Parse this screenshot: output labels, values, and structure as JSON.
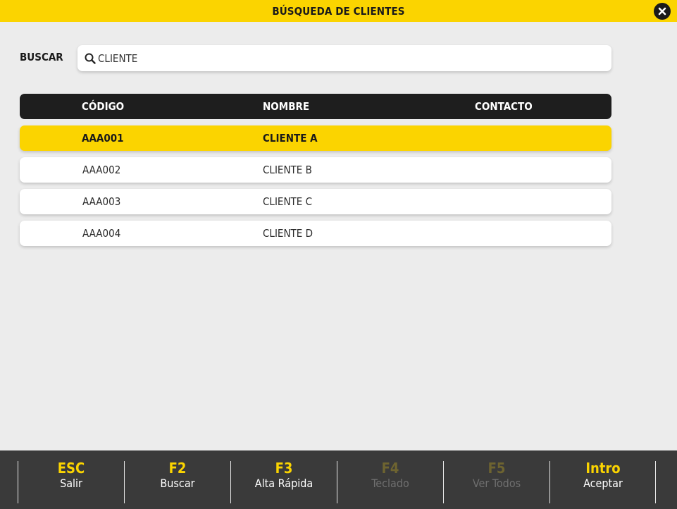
{
  "window": {
    "title": "BÚSQUEDA DE CLIENTES"
  },
  "search": {
    "label": "BUSCAR",
    "value": "CLIENTE",
    "icon": "search-icon"
  },
  "table": {
    "headers": [
      "CÓDIGO",
      "NOMBRE",
      "CONTACTO"
    ],
    "rows": [
      {
        "code": "AAA001",
        "name": "CLIENTE A",
        "contact": "",
        "selected": true
      },
      {
        "code": "AAA002",
        "name": "CLIENTE B",
        "contact": "",
        "selected": false
      },
      {
        "code": "AAA003",
        "name": "CLIENTE C",
        "contact": "",
        "selected": false
      },
      {
        "code": "AAA004",
        "name": "CLIENTE D",
        "contact": "",
        "selected": false
      }
    ]
  },
  "footer": {
    "keys": [
      {
        "key": "ESC",
        "label": "Salir",
        "enabled": true
      },
      {
        "key": "F2",
        "label": "Buscar",
        "enabled": true
      },
      {
        "key": "F3",
        "label": "Alta Rápida",
        "enabled": true
      },
      {
        "key": "F4",
        "label": "Teclado",
        "enabled": false
      },
      {
        "key": "F5",
        "label": "Ver Todos",
        "enabled": false
      },
      {
        "key": "Intro",
        "label": "Aceptar",
        "enabled": true
      }
    ]
  },
  "colors": {
    "accent": "#fbd400",
    "header_bg": "#1e1e1e",
    "footer_bg": "#3a3a3a",
    "page_bg": "#ececec"
  }
}
